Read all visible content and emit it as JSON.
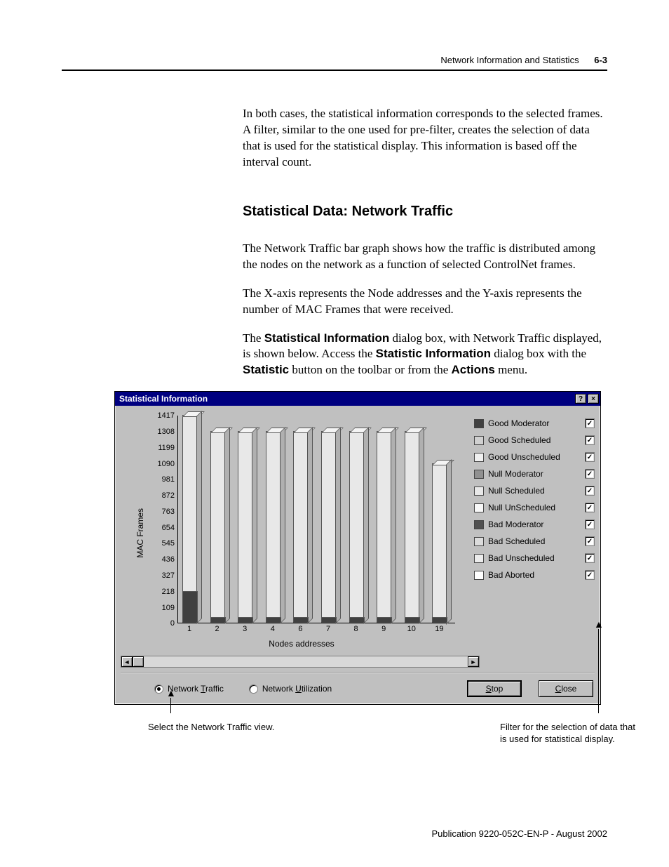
{
  "running_head": {
    "text": "Network Information and Statistics",
    "page": "6-3"
  },
  "para1": "In both cases, the statistical information corresponds to the selected frames. A filter, similar to the one used for pre-filter, creates the selection of data that is used for the statistical display. This information is based off the interval count.",
  "section_heading": "Statistical Data: Network Traffic",
  "para2": "The Network Traffic bar graph shows how the traffic is distributed among the nodes on the network as a function of selected ControlNet frames.",
  "para3": "The X-axis represents the Node addresses and the Y-axis represents the number of MAC Frames that were received.",
  "para4_pre": "The ",
  "para4_b1": "Statistical Information",
  "para4_mid1": " dialog box, with Network Traffic displayed, is shown below. Access the ",
  "para4_b2": "Statistic Information",
  "para4_mid2": " dialog box with the ",
  "para4_b3": "Statistic",
  "para4_mid3": " button on the toolbar or from the ",
  "para4_b4": "Actions",
  "para4_end": " menu.",
  "dialog": {
    "title": "Statistical Information",
    "help_btn": "?",
    "close_btn": "×",
    "ylabel": "MAC Frames",
    "xlabel": "Nodes addresses",
    "legend": [
      {
        "label": "Good Moderator",
        "color": "#404040",
        "checked": true
      },
      {
        "label": "Good Scheduled",
        "color": "#d0d0d0",
        "checked": true
      },
      {
        "label": "Good Unscheduled",
        "color": "#f0f0f0",
        "checked": true
      },
      {
        "label": "Null Moderator",
        "color": "#909090",
        "checked": true
      },
      {
        "label": "Null Scheduled",
        "color": "#e8e8e8",
        "checked": true
      },
      {
        "label": "Null UnScheduled",
        "color": "#f8f8f8",
        "checked": true
      },
      {
        "label": "Bad Moderator",
        "color": "#505050",
        "checked": true
      },
      {
        "label": "Bad Scheduled",
        "color": "#dcdcdc",
        "checked": true
      },
      {
        "label": "Bad Unscheduled",
        "color": "#ececec",
        "checked": true
      },
      {
        "label": "Bad Aborted",
        "color": "#ffffff",
        "checked": true
      }
    ],
    "radio": {
      "network_traffic": "Network Traffic",
      "network_utilization": "Network Utilization"
    },
    "buttons": {
      "stop": "Stop",
      "close": "Close"
    }
  },
  "chart_data": {
    "type": "bar",
    "title": "",
    "xlabel": "Nodes addresses",
    "ylabel": "MAC Frames",
    "ylim": [
      0,
      1417
    ],
    "yticks": [
      0,
      109,
      218,
      327,
      436,
      545,
      654,
      763,
      872,
      981,
      1090,
      1199,
      1308,
      1417
    ],
    "categories": [
      "1",
      "2",
      "3",
      "4",
      "6",
      "7",
      "8",
      "9",
      "10",
      "19"
    ],
    "values": [
      1417,
      1308,
      1308,
      1308,
      1308,
      1308,
      1308,
      1308,
      1308,
      1090
    ],
    "dark_segment_values": [
      218,
      40,
      40,
      40,
      40,
      40,
      40,
      40,
      40,
      40
    ]
  },
  "annotations": {
    "left": "Select the Network Traffic view.",
    "right": "Filter for the selection of data that is used for statistical display."
  },
  "footer": "Publication 9220-052C-EN-P - August 2002"
}
